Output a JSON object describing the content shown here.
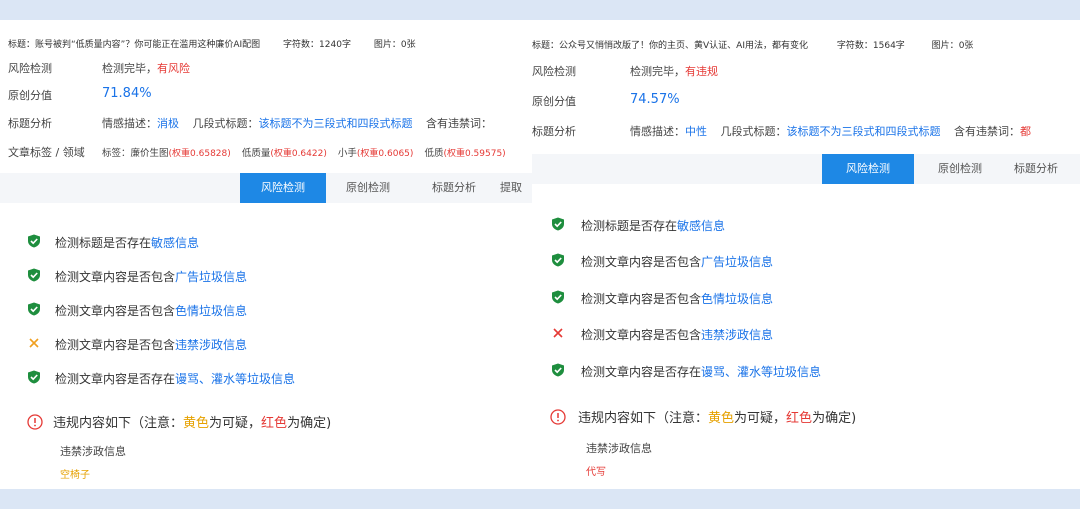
{
  "left": {
    "title_prefix": "标题：",
    "title": "账号被判“低质量内容”？你可能正在滥用这种廉价AI配图",
    "char_count_label": "字符数：",
    "char_count": "1240字",
    "images_label": "图片：",
    "images": "0张",
    "risk_label": "风险检测",
    "risk_text": "检测完毕，",
    "risk_result": "有风险",
    "orig_label": "原创分值",
    "orig_score": "71.84%",
    "title_label": "标题分析",
    "sentiment_label": "情感描述：",
    "sentiment": "消极",
    "segment_label": "几段式标题：",
    "segment": "该标题不为三段式和四段式标题",
    "banned_label": "含有违禁词：",
    "tags_label": "文章标签 / 领域",
    "tags_prefix": "标签：",
    "tags": [
      {
        "name": "廉价生图",
        "weight": "(权重0.65828)"
      },
      {
        "name": "低质量",
        "weight": "(权重0.6422)"
      },
      {
        "name": "小手",
        "weight": "(权重0.6065)"
      },
      {
        "name": "低质",
        "weight": "(权重0.59575)"
      }
    ],
    "tabs": [
      "风险检测",
      "原创检测",
      "标题分析",
      "提取"
    ],
    "checks": [
      {
        "pre": "检测标题是否存在",
        "hl": "敏感信息",
        "status": "ok"
      },
      {
        "pre": "检测文章内容是否包含",
        "hl": "广告垃圾信息",
        "status": "ok"
      },
      {
        "pre": "检测文章内容是否包含",
        "hl": "色情垃圾信息",
        "status": "ok"
      },
      {
        "pre": "检测文章内容是否包含",
        "hl": "违禁涉政信息",
        "status": "warn"
      },
      {
        "pre": "检测文章内容是否存在",
        "hl": "谩骂、灌水等垃圾信息",
        "status": "ok"
      }
    ],
    "violation_title_a": "违规内容如下（注意：",
    "violation_yellow": "黄色",
    "violation_mid": "为可疑，",
    "violation_red": "红色",
    "violation_end": "为确定)",
    "violation_category": "违禁涉政信息",
    "violation_word": "空椅子"
  },
  "right": {
    "title_prefix": "标题：",
    "title": "公众号又悄悄改版了！你的主页、黄V认证、AI用法，都有变化",
    "char_count_label": "字符数：",
    "char_count": "1564字",
    "images_label": "图片：",
    "images": "0张",
    "risk_label": "风险检测",
    "risk_text": "检测完毕，",
    "risk_result": "有违规",
    "orig_label": "原创分值",
    "orig_score": "74.57%",
    "title_label": "标题分析",
    "sentiment_label": "情感描述：",
    "sentiment": "中性",
    "segment_label": "几段式标题：",
    "segment": "该标题不为三段式和四段式标题",
    "banned_label": "含有违禁词：",
    "banned": "都",
    "tabs": [
      "风险检测",
      "原创检测",
      "标题分析"
    ],
    "checks": [
      {
        "pre": "检测标题是否存在",
        "hl": "敏感信息",
        "status": "ok"
      },
      {
        "pre": "检测文章内容是否包含",
        "hl": "广告垃圾信息",
        "status": "ok"
      },
      {
        "pre": "检测文章内容是否包含",
        "hl": "色情垃圾信息",
        "status": "ok"
      },
      {
        "pre": "检测文章内容是否包含",
        "hl": "违禁涉政信息",
        "status": "bad"
      },
      {
        "pre": "检测文章内容是否存在",
        "hl": "谩骂、灌水等垃圾信息",
        "status": "ok"
      }
    ],
    "violation_title_a": "违规内容如下（注意：",
    "violation_yellow": "黄色",
    "violation_mid": "为可疑，",
    "violation_red": "红色",
    "violation_end": "为确定)",
    "violation_category": "违禁涉政信息",
    "violation_word": "代写"
  },
  "colors": {
    "accent": "#1e88e5",
    "ok": "#1e8e3e",
    "warn": "#f0a020",
    "bad": "#e53935"
  }
}
